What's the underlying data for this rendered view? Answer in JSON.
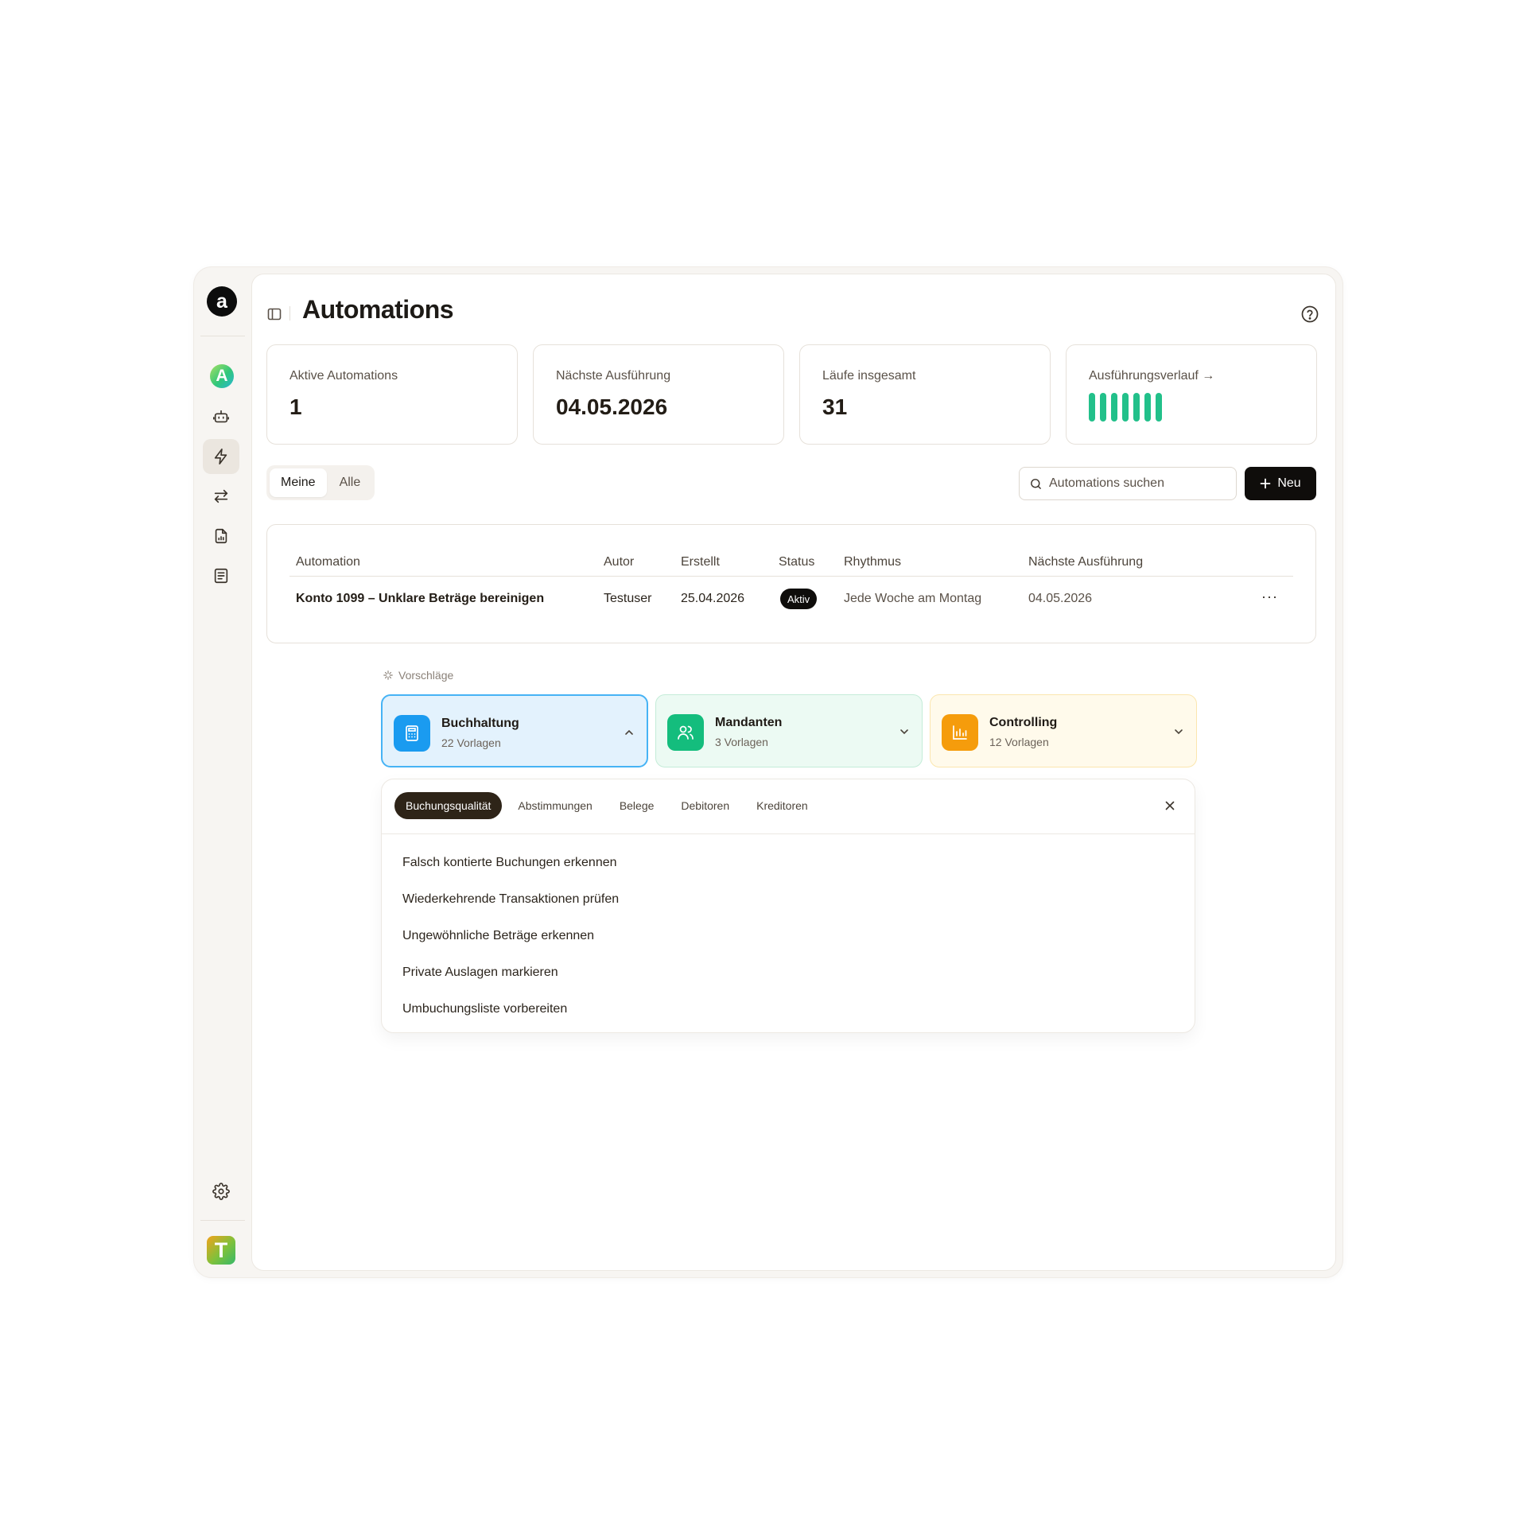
{
  "app": {
    "logo_letter": "a",
    "workspace_initial": "A",
    "user_initial": "T"
  },
  "header": {
    "title": "Automations"
  },
  "stats": [
    {
      "label": "Aktive Automations",
      "value": "1"
    },
    {
      "label": "Nächste Ausführung",
      "value": "04.05.2026"
    },
    {
      "label": "Läufe insgesamt",
      "value": "31"
    },
    {
      "label": "Ausführungsverlauf →",
      "bar_count": 7,
      "bar_color": "#22c08a"
    }
  ],
  "filter": {
    "options": [
      "Meine",
      "Alle"
    ],
    "selected": "Meine"
  },
  "search": {
    "placeholder": "Automations suchen"
  },
  "new_button": {
    "label": "Neu"
  },
  "table": {
    "columns": [
      "Automation",
      "Autor",
      "Erstellt",
      "Status",
      "Rhythmus",
      "Nächste Ausführung"
    ],
    "rows": [
      {
        "automation": "Konto 1099 – Unklare Beträge bereinigen",
        "autor": "Testuser",
        "erstellt": "25.04.2026",
        "status": "Aktiv",
        "rhythmus": "Jede Woche am Montag",
        "naechste": "04.05.2026",
        "actions": "···"
      }
    ]
  },
  "suggestions": {
    "label": "Vorschläge",
    "categories": [
      {
        "name": "Buchhaltung",
        "sub": "22 Vorlagen",
        "icon": "calculator-icon",
        "accent": "#1a9bf0",
        "expanded": true
      },
      {
        "name": "Mandanten",
        "sub": "3 Vorlagen",
        "icon": "users-icon",
        "accent": "#14bd7d",
        "expanded": false
      },
      {
        "name": "Controlling",
        "sub": "12 Vorlagen",
        "icon": "bar-chart-icon",
        "accent": "#f59c0c",
        "expanded": false
      }
    ],
    "tabs": [
      "Buchungsqualität",
      "Abstimmungen",
      "Belege",
      "Debitoren",
      "Kreditoren"
    ],
    "active_tab": "Buchungsqualität",
    "items": [
      "Falsch kontierte Buchungen erkennen",
      "Wiederkehrende Transaktionen prüfen",
      "Ungewöhnliche Beträge erkennen",
      "Private Auslagen markieren",
      "Umbuchungsliste vorbereiten"
    ]
  }
}
